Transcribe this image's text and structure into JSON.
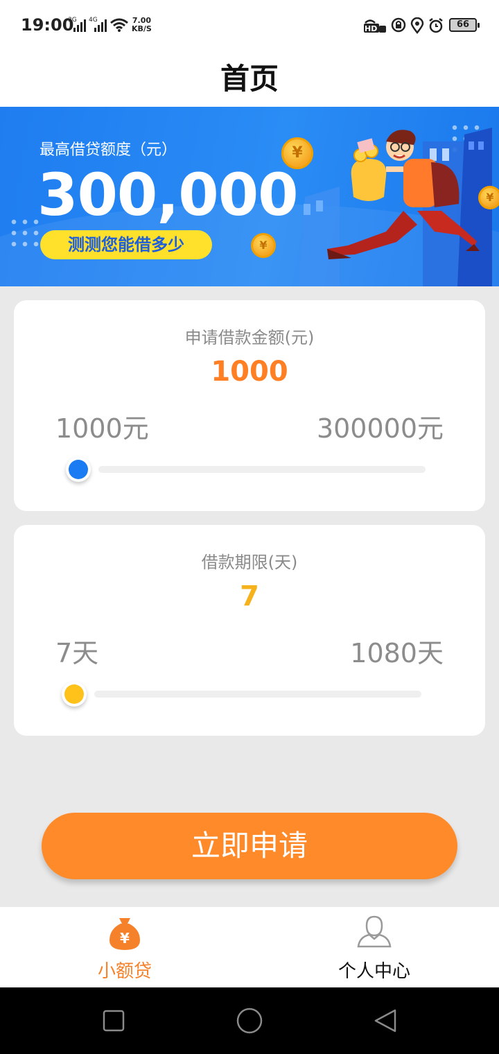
{
  "status_bar": {
    "time": "19:00",
    "signal1_label": "3G",
    "signal2_label": "4G",
    "speed_value": "7.00",
    "speed_unit": "KB/S",
    "hd_label": "HD",
    "battery": "66"
  },
  "header": {
    "title": "首页"
  },
  "banner": {
    "subtitle": "最高借贷额度（元）",
    "amount": "300,000",
    "cta": "测测您能借多少",
    "coin_symbol": "¥"
  },
  "amount_card": {
    "label": "申请借款金额(元)",
    "value": "1000",
    "min": "1000元",
    "max": "300000元",
    "slider_fraction": 0,
    "accent": "#ff7f24",
    "knob_color": "#1a7bf2"
  },
  "term_card": {
    "label": "借款期限(天)",
    "value": "7",
    "min": "7天",
    "max": "1080天",
    "slider_fraction": 0,
    "accent": "#f6b21c",
    "knob_color": "#ffc21a"
  },
  "apply_button": {
    "label": "立即申请"
  },
  "tabs": [
    {
      "label": "小额贷",
      "icon": "money-bag-icon",
      "active": true,
      "color": "#f5822a"
    },
    {
      "label": "个人中心",
      "icon": "user-icon",
      "active": false,
      "color": "#111111"
    }
  ],
  "nav": {
    "icons": [
      "square-recent-icon",
      "circle-home-icon",
      "triangle-back-icon"
    ]
  }
}
